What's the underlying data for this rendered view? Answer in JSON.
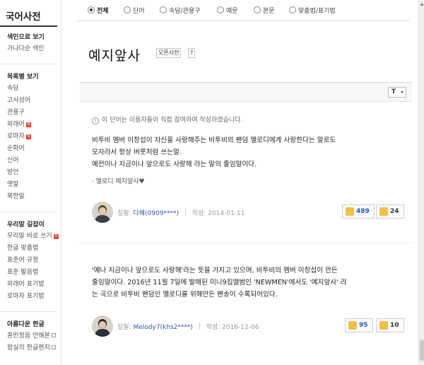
{
  "sidebar": {
    "brand": "국어사전",
    "top_items": [
      "색인으로 보기",
      "가나다순 색인"
    ],
    "category_head": "목록별 보기",
    "categories": [
      {
        "label": "속담",
        "badge": ""
      },
      {
        "label": "고사성어",
        "badge": ""
      },
      {
        "label": "관용구",
        "badge": ""
      },
      {
        "label": "외래어",
        "badge": "N"
      },
      {
        "label": "로마자",
        "badge": "N"
      },
      {
        "label": "순화어",
        "badge": ""
      },
      {
        "label": "신어",
        "badge": ""
      },
      {
        "label": "방언",
        "badge": ""
      },
      {
        "label": "옛말",
        "badge": ""
      },
      {
        "label": "북한말",
        "badge": ""
      }
    ],
    "guide_head": "우리말 길잡이",
    "guides": [
      {
        "label": "우리말 바로 쓰기",
        "badge": "N"
      },
      {
        "label": "한글 맞춤법",
        "badge": ""
      },
      {
        "label": "표준어 규정",
        "badge": ""
      },
      {
        "label": "표준 발음법",
        "badge": ""
      },
      {
        "label": "외래어 표기법",
        "badge": ""
      },
      {
        "label": "로마자 표기법",
        "badge": ""
      }
    ],
    "hangul_head": "아름다운 한글",
    "hangul_items": [
      "훈민정음 언해본",
      "왕실의 한글편지"
    ]
  },
  "filters": [
    {
      "label": "전체",
      "selected": true
    },
    {
      "label": "단어",
      "selected": false
    },
    {
      "label": "속담/관용구",
      "selected": false
    },
    {
      "label": "예문",
      "selected": false
    },
    {
      "label": "본문",
      "selected": false
    },
    {
      "label": "맞춤법/표기법",
      "selected": false
    }
  ],
  "title": "예지앞사",
  "title_source": "오픈사전",
  "title_help": "?",
  "toolbar": {
    "font_button": "T"
  },
  "notice": "이 단어는 이용자들이 직접 참여하여 작성하였습니다.",
  "entries": [
    {
      "lines": [
        "비투비 멤버 이창섭이 자신을 사랑해주는 비투비의 팬덤 멜로디에게 사랑한다는 말로도",
        "모자라서 항상 버릇처럼 쓰는말.",
        "예전이나 지금이나 앞으로도 사랑해 라는 말의 줄임말이다."
      ],
      "example": "· 멜로디 예지앞사♥",
      "author_label": "집필:",
      "author": "다혜(0909****)",
      "date_label": "작성:",
      "date": "2014-01-11",
      "up": "489",
      "down": "24"
    },
    {
      "lines": [
        "'예나 지금이나 앞으로도 사랑해'라는 뜻을 가지고 있으며, 비투비의 멤버 이창섭이 만든",
        "줄임말이다. 2016년 11월 7일에 발매된 미니9집앨범인 'NEWMEN'에서도 '예지앞사' 라",
        "는 곡으로 비투비 팬덤인 멜로디를 위해만든 팬송이 수록되어있다."
      ],
      "example": "",
      "author_label": "집필:",
      "author": "Melody7(khs2****)",
      "date_label": "작성:",
      "date": "2016-12-06",
      "up": "95",
      "down": "10"
    }
  ],
  "colors": {
    "badge": "#e8442e",
    "author": "#3355aa",
    "vote_up": "#2a5bb8",
    "thumb": "#f0c04a"
  }
}
